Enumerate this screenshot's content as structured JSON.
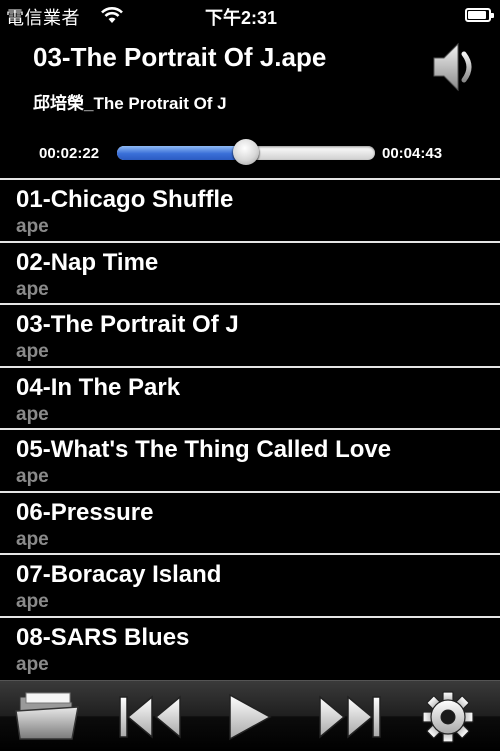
{
  "status_bar": {
    "carrier": "電信業者",
    "time": "下午2:31",
    "battery_level": 0.9
  },
  "now_playing": {
    "title": "03-The Portrait Of J.ape",
    "album": "邱培榮_The Protrait Of J",
    "elapsed": "00:02:22",
    "total": "00:04:43",
    "progress": 0.5
  },
  "tracks": [
    {
      "name": "01-Chicago Shuffle",
      "format": "ape"
    },
    {
      "name": "02-Nap Time",
      "format": "ape"
    },
    {
      "name": "03-The Portrait Of J",
      "format": "ape"
    },
    {
      "name": "04-In The Park",
      "format": "ape"
    },
    {
      "name": "05-What's The Thing Called Love",
      "format": "ape"
    },
    {
      "name": "06-Pressure",
      "format": "ape"
    },
    {
      "name": "07-Boracay Island",
      "format": "ape"
    },
    {
      "name": "08-SARS Blues",
      "format": "ape"
    }
  ],
  "toolbar": {
    "icons": [
      "folder-icon",
      "previous-icon",
      "play-icon",
      "next-icon",
      "settings-gear-icon"
    ]
  },
  "colors": {
    "background": "#000000",
    "progress_fill": "#3a6fd8",
    "format_text": "#8a8a8a",
    "divider": "#e5e5e5"
  }
}
